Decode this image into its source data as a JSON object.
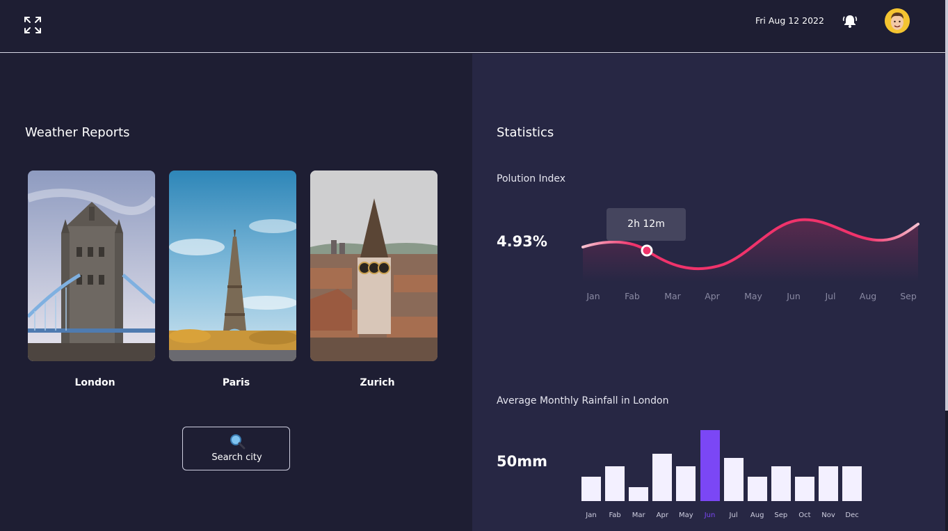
{
  "header": {
    "date": "Fri Aug 12 2022",
    "expand_icon": "expand-arrows-icon",
    "bell_icon": "bell-icon",
    "avatar": "user-avatar"
  },
  "weather": {
    "title": "Weather Reports",
    "cities": [
      {
        "name": "London"
      },
      {
        "name": "Paris"
      },
      {
        "name": "Zurich"
      }
    ],
    "search_label": "Search city",
    "search_icon": "magnifier-icon"
  },
  "stats": {
    "title": "Statistics",
    "pollution": {
      "title": "Polution Index",
      "value": "4.93%",
      "tooltip": "2h 12m",
      "months": [
        "Jan",
        "Fab",
        "Mar",
        "Apr",
        "May",
        "Jun",
        "Jul",
        "Aug",
        "Sep"
      ]
    },
    "rainfall": {
      "title": "Average Monthly Rainfall in London",
      "value": "50mm",
      "months": [
        "Jan",
        "Fab",
        "Mar",
        "Apr",
        "May",
        "Jun",
        "Jul",
        "Aug",
        "Sep",
        "Oct",
        "Nov",
        "Dec"
      ],
      "values": [
        35,
        50,
        20,
        68,
        50,
        102,
        62,
        35,
        50,
        35,
        50,
        50
      ],
      "highlight_month": "Jun",
      "highlight_color": "#7b47f5",
      "bar_color": "#f3f0ff"
    }
  },
  "colors": {
    "background": "#1e1e33",
    "panel": "#272744",
    "line_accent": "#f0336b"
  }
}
